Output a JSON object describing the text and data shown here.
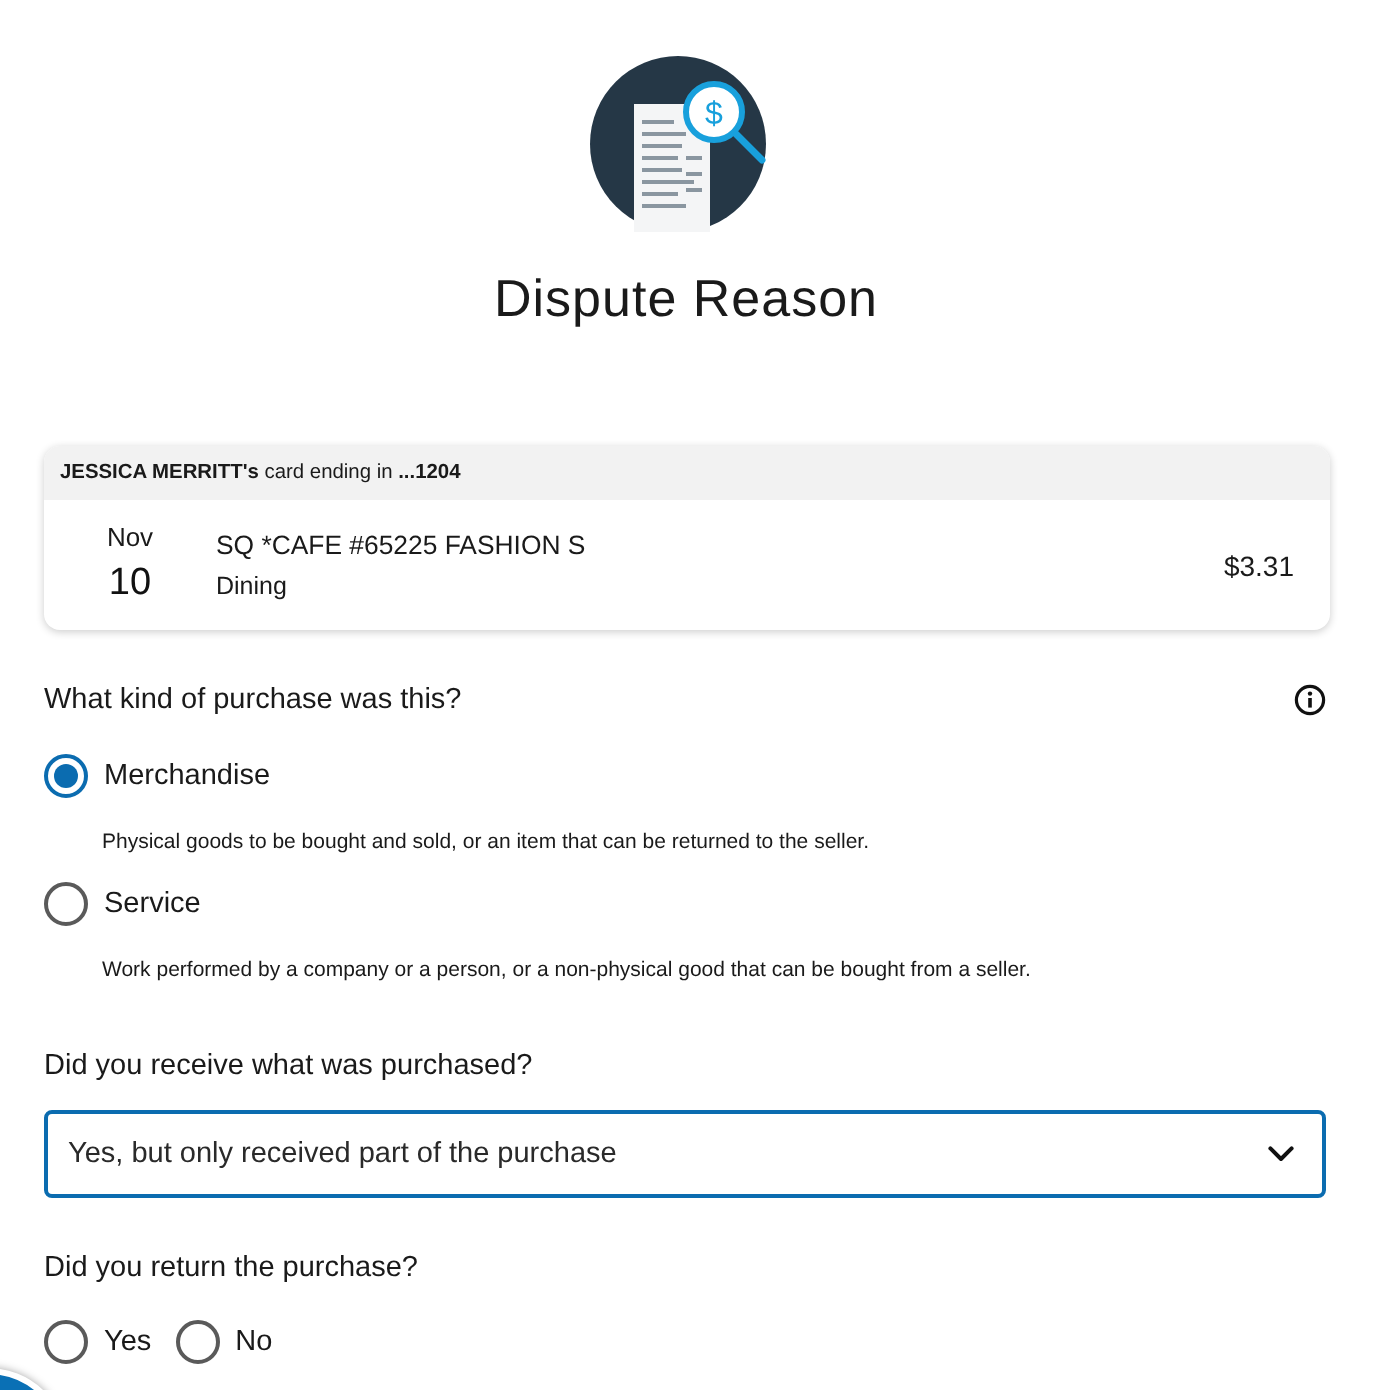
{
  "header": {
    "icon_glyph": "$",
    "title": "Dispute Reason"
  },
  "transaction": {
    "card_line": "**JESSICA MERRITT's** card ending in **...1204**",
    "month": "Nov",
    "day": "10",
    "merchant": "SQ *CAFE #65225 FASHION S",
    "category": "Dining",
    "amount": "$3.31"
  },
  "questions": [
    {
      "kind": "radio",
      "prompt": "What kind of purchase was this?",
      "info": true,
      "options": [
        {
          "label": "Merchandise",
          "description": "Physical goods to be bought and sold, or an item that can be returned to the seller.",
          "selected": true
        },
        {
          "label": "Service",
          "description": "Work performed by a company or a person, or a non-physical good that can be bought from a seller.",
          "selected": false
        }
      ]
    },
    {
      "kind": "select",
      "prompt": "Did you receive what was purchased?",
      "value": "Yes, but only received part of the purchase"
    },
    {
      "kind": "radio",
      "prompt": "Did you return the purchase?",
      "options": [
        {
          "label": "Yes",
          "selected": false
        },
        {
          "label": "No",
          "selected": false
        }
      ]
    }
  ]
}
